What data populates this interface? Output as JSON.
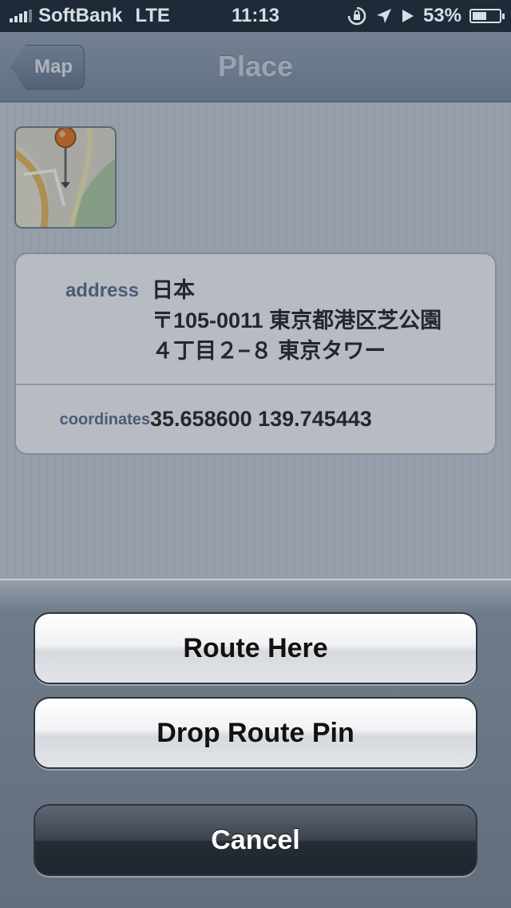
{
  "status_bar": {
    "carrier": "SoftBank",
    "network": "LTE",
    "time": "11:13",
    "battery_percent": "53%",
    "battery_level": 0.53
  },
  "nav_bar": {
    "back_label": "Map",
    "title": "Place"
  },
  "place": {
    "address_label": "address",
    "address_lines": [
      "日本",
      "〒105-0011 東京都港区芝公園",
      "４丁目２−８ 東京タワー"
    ],
    "coordinates_label": "coordinates",
    "coordinates_value": "35.658600 139.745443"
  },
  "action_sheet": {
    "route_here": "Route Here",
    "drop_route_pin": "Drop Route Pin",
    "cancel": "Cancel"
  },
  "colors": {
    "label_blue": "#4f6286",
    "pin_orange": "#e06a10"
  },
  "icons": {
    "signal": "signal-bars-icon",
    "rotation_lock": "rotation-lock-icon",
    "location": "location-arrow-icon",
    "play": "play-icon",
    "battery": "battery-icon",
    "pin": "map-pin-icon"
  }
}
